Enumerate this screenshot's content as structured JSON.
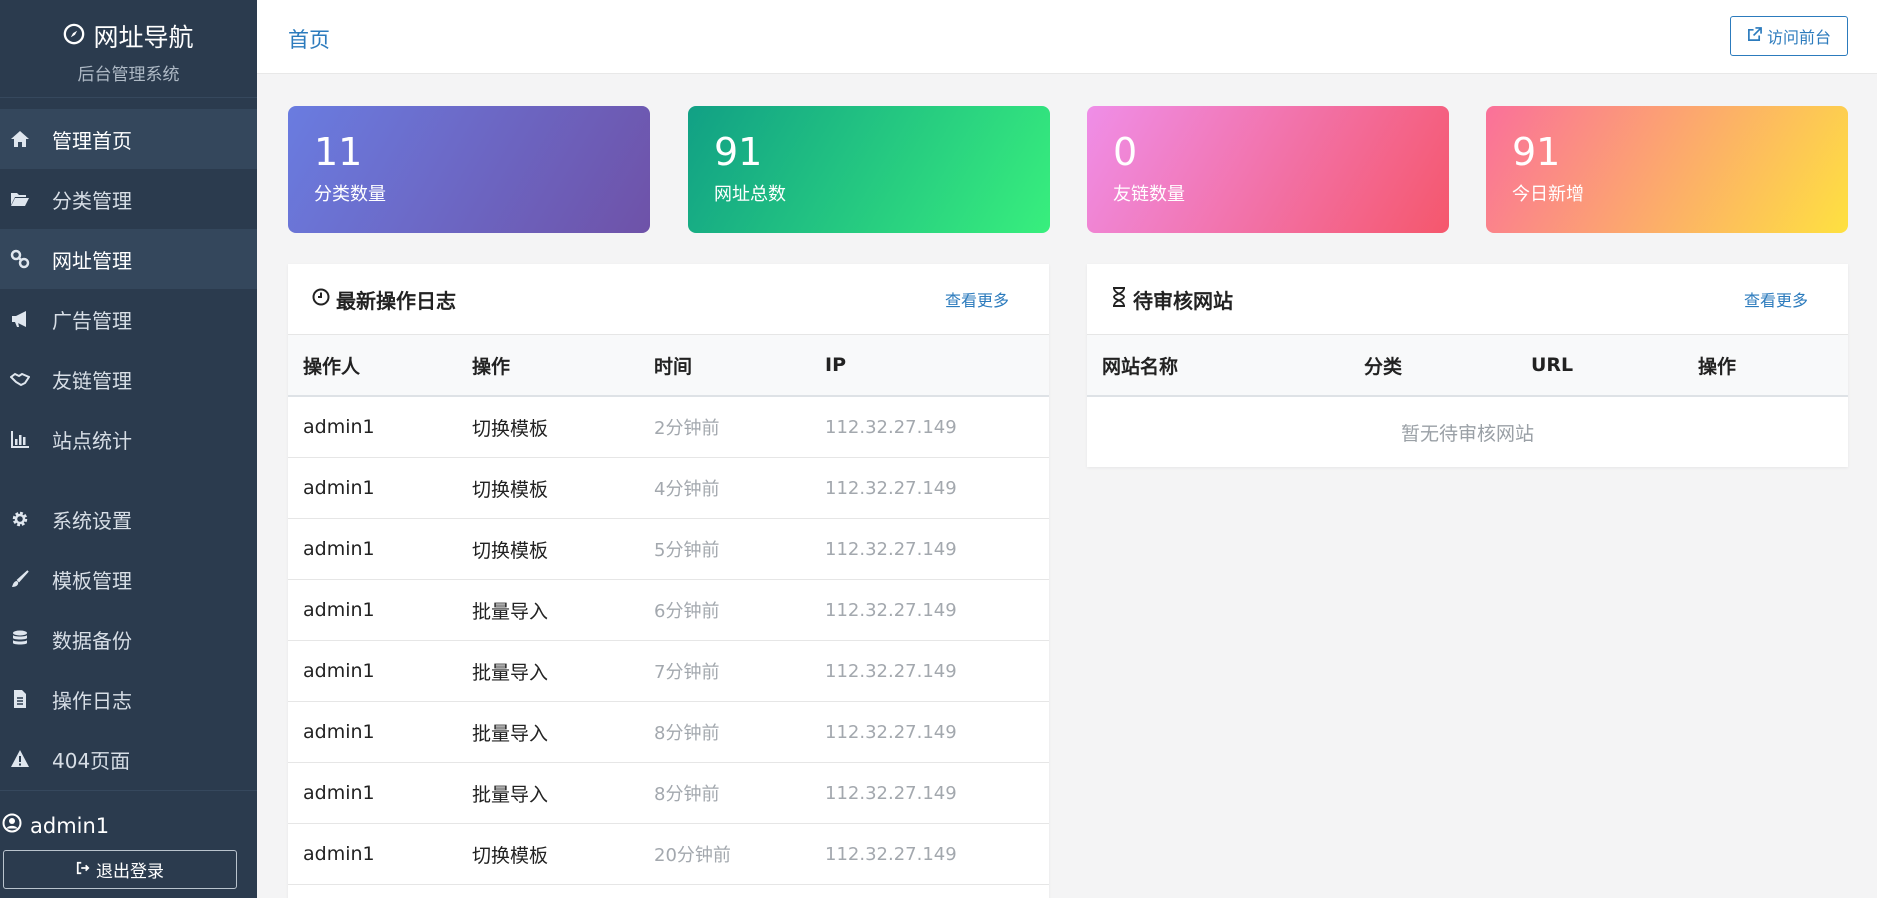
{
  "brand": {
    "title": "网址导航",
    "subtitle": "后台管理系统"
  },
  "nav": {
    "items": [
      {
        "label": "管理首页",
        "icon": "home-icon"
      },
      {
        "label": "分类管理",
        "icon": "folder-open-icon"
      },
      {
        "label": "网址管理",
        "icon": "link-icon"
      },
      {
        "label": "广告管理",
        "icon": "bullhorn-icon"
      },
      {
        "label": "友链管理",
        "icon": "handshake-icon"
      },
      {
        "label": "站点统计",
        "icon": "bar-chart-icon"
      },
      {
        "label": "系统设置",
        "icon": "gear-icon"
      },
      {
        "label": "模板管理",
        "icon": "brush-icon"
      },
      {
        "label": "数据备份",
        "icon": "database-icon"
      },
      {
        "label": "操作日志",
        "icon": "file-text-icon"
      },
      {
        "label": "404页面",
        "icon": "warning-icon"
      }
    ]
  },
  "user": {
    "name": "admin1",
    "logout_label": "退出登录"
  },
  "topbar": {
    "breadcrumb": "首页",
    "visit_label": "访问前台"
  },
  "stats": [
    {
      "value": "11",
      "label": "分类数量"
    },
    {
      "value": "91",
      "label": "网址总数"
    },
    {
      "value": "0",
      "label": "友链数量"
    },
    {
      "value": "91",
      "label": "今日新增"
    }
  ],
  "log_panel": {
    "title": "最新操作日志",
    "more": "查看更多",
    "headers": [
      "操作人",
      "操作",
      "时间",
      "IP"
    ],
    "rows": [
      [
        "admin1",
        "切换模板",
        "2分钟前",
        "112.32.27.149"
      ],
      [
        "admin1",
        "切换模板",
        "4分钟前",
        "112.32.27.149"
      ],
      [
        "admin1",
        "切换模板",
        "5分钟前",
        "112.32.27.149"
      ],
      [
        "admin1",
        "批量导入",
        "6分钟前",
        "112.32.27.149"
      ],
      [
        "admin1",
        "批量导入",
        "7分钟前",
        "112.32.27.149"
      ],
      [
        "admin1",
        "批量导入",
        "8分钟前",
        "112.32.27.149"
      ],
      [
        "admin1",
        "批量导入",
        "8分钟前",
        "112.32.27.149"
      ],
      [
        "admin1",
        "切换模板",
        "20分钟前",
        "112.32.27.149"
      ]
    ]
  },
  "pending_panel": {
    "title": "待审核网站",
    "more": "查看更多",
    "headers": [
      "网站名称",
      "分类",
      "URL",
      "操作"
    ],
    "empty_text": "暂无待审核网站"
  },
  "colors": {
    "sidebar": "#2b3b4e",
    "accent": "#2c7bbd"
  }
}
